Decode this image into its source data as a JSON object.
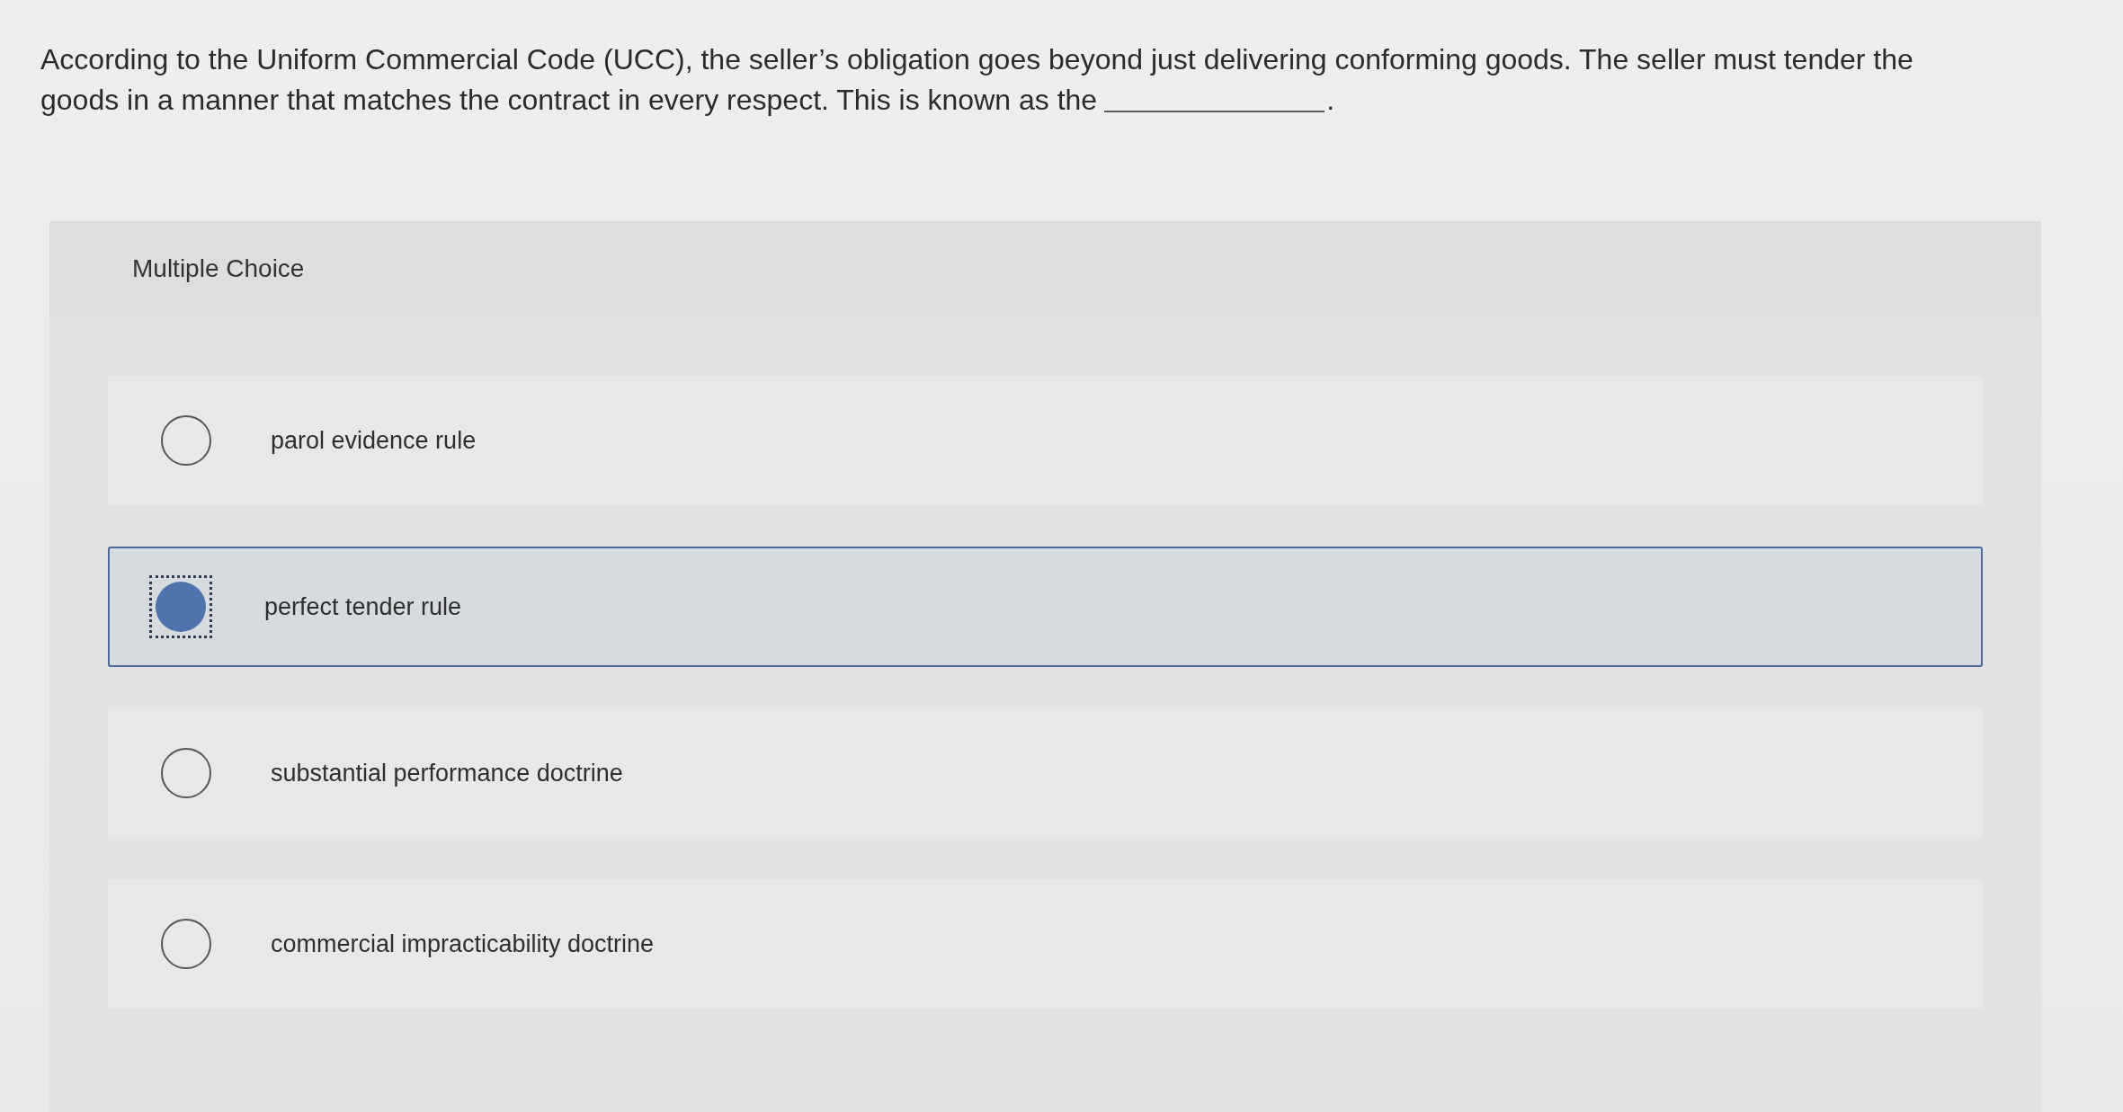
{
  "question": {
    "lines": [
      "According to the Uniform Commercial Code (UCC), the seller’s obligation goes beyond just delivering conforming goods. The seller must tender the",
      "goods in a manner that matches the contract in every respect. This is known as the"
    ],
    "after_blank": "."
  },
  "choices": {
    "title": "Multiple Choice",
    "options": [
      {
        "label": "parol evidence rule",
        "selected": false
      },
      {
        "label": "perfect tender rule",
        "selected": true
      },
      {
        "label": "substantial performance doctrine",
        "selected": false
      },
      {
        "label": "commercial impracticability doctrine",
        "selected": false
      }
    ]
  }
}
